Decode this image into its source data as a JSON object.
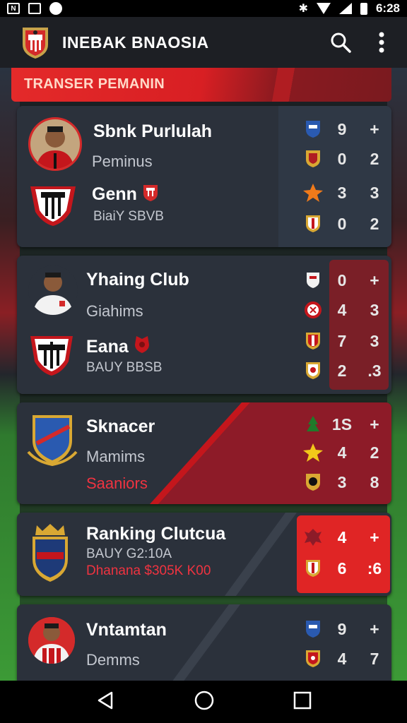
{
  "status_bar": {
    "time": "6:28",
    "left_icon_label": "N"
  },
  "app_bar": {
    "title": "INEBAK BNAOSIA"
  },
  "section": {
    "title": "TRANSER PEMANIN"
  },
  "cards": [
    {
      "name": "Sbnk Purlulah",
      "subtitle": "Peminus",
      "club_name": "Genn",
      "club_sub": "BiaiY SBVB",
      "stats": [
        {
          "icon": "shield-blue-icon",
          "a": "9",
          "b": "+"
        },
        {
          "icon": "shield-gold-icon",
          "a": "0",
          "b": "2"
        },
        {
          "icon": "star-orange-icon",
          "a": "3",
          "b": "3"
        },
        {
          "icon": "shield-red-icon",
          "a": "0",
          "b": "2"
        }
      ]
    },
    {
      "name": "Yhaing Club",
      "subtitle": "Giahims",
      "club_name": "Eana",
      "club_sub": "BAUY BBSB",
      "stats": [
        {
          "icon": "shield-white-icon",
          "a": "0",
          "b": "+"
        },
        {
          "icon": "badge-red-icon",
          "a": "4",
          "b": "3"
        },
        {
          "icon": "shield-red-icon",
          "a": "7",
          "b": "3"
        },
        {
          "icon": "shield-gold-icon",
          "a": "2",
          "b": ".3"
        }
      ]
    },
    {
      "name": "Sknacer",
      "subtitle": "Mamims",
      "tagline": "Saaniors",
      "stats": [
        {
          "icon": "tree-green-icon",
          "a": "1S",
          "b": "+"
        },
        {
          "icon": "star-yellow-icon",
          "a": "4",
          "b": "2"
        },
        {
          "icon": "shield-gold-icon",
          "a": "3",
          "b": "8"
        }
      ]
    },
    {
      "name": "Ranking Clutcua",
      "subtitle": "BAUY G2:10A",
      "tagline": "Dhanana $305K K00",
      "stats": [
        {
          "icon": "eagle-red-icon",
          "a": "4",
          "b": "+"
        },
        {
          "icon": "shield-red-icon",
          "a": "6",
          "b": ":6"
        }
      ]
    },
    {
      "name": "Vntamtan",
      "subtitle": "Demms",
      "stats": [
        {
          "icon": "shield-blue-icon",
          "a": "9",
          "b": "+"
        },
        {
          "icon": "shield-red-icon",
          "a": "4",
          "b": "7"
        }
      ]
    }
  ],
  "colors": {
    "accent_red": "#e42a2a",
    "card_bg": "#2b313b",
    "app_bar_bg": "#1d1f24",
    "highlight_red": "#e02525"
  }
}
